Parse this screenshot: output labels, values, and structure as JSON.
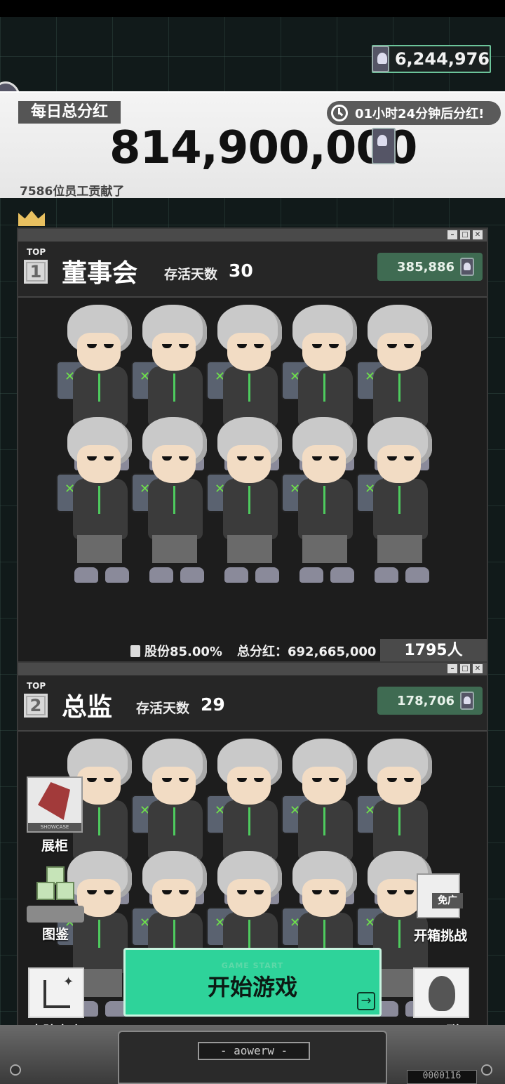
{
  "header": {
    "coin_balance": "6,244,976"
  },
  "daily": {
    "title": "每日总分红",
    "timer": "01小时24分钟后分红!",
    "amount": "814,900,000",
    "contributors": "7586位员工贡献了"
  },
  "panels": [
    {
      "top_label": "TOP",
      "rank": "1",
      "name": "董事会",
      "survive_label": "存活天数",
      "survive_days": "30",
      "score": "385,886",
      "share": "股份85.00%",
      "total_dividend": "总分红：692,665,000",
      "people": "1795人"
    },
    {
      "top_label": "TOP",
      "rank": "2",
      "name": "总监",
      "survive_label": "存活天数",
      "survive_days": "29",
      "score": "178,706"
    }
  ],
  "side_menu": {
    "showcase": "展柜",
    "codex": "图鉴",
    "skin_shop": "皮肤商店",
    "chest_challenge": "开箱挑战",
    "chest_badge": "免广",
    "qq_group": "QQ群"
  },
  "start_button": {
    "subtitle": "GAME START",
    "label": "开始游戏"
  },
  "console": {
    "logo": "- aowerw -",
    "counter": "0000116"
  },
  "colors": {
    "accent_green": "#2ed39a",
    "score_pill": "#3f6b52",
    "crown": "#e8c060"
  }
}
